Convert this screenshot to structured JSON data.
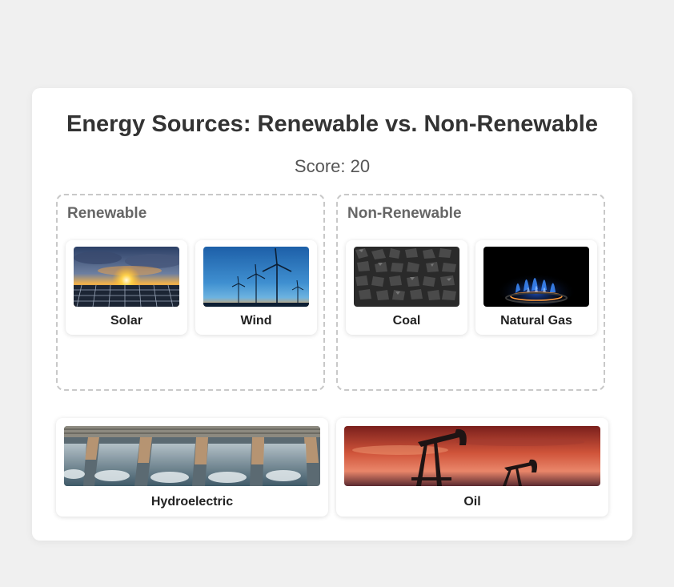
{
  "page": {
    "title": "Energy Sources: Renewable vs. Non-Renewable",
    "score": "Score: 20"
  },
  "zones": {
    "renewable": {
      "label": "Renewable",
      "items": [
        {
          "label": "Solar",
          "image": "solar-panels-sunset-image"
        },
        {
          "label": "Wind",
          "image": "wind-turbines-image"
        }
      ]
    },
    "non_renewable": {
      "label": "Non-Renewable",
      "items": [
        {
          "label": "Coal",
          "image": "coal-pile-image"
        },
        {
          "label": "Natural Gas",
          "image": "gas-flame-image"
        }
      ]
    }
  },
  "unsorted": [
    {
      "label": "Hydroelectric",
      "image": "dam-spillway-image"
    },
    {
      "label": "Oil",
      "image": "oil-pumpjack-image"
    }
  ]
}
